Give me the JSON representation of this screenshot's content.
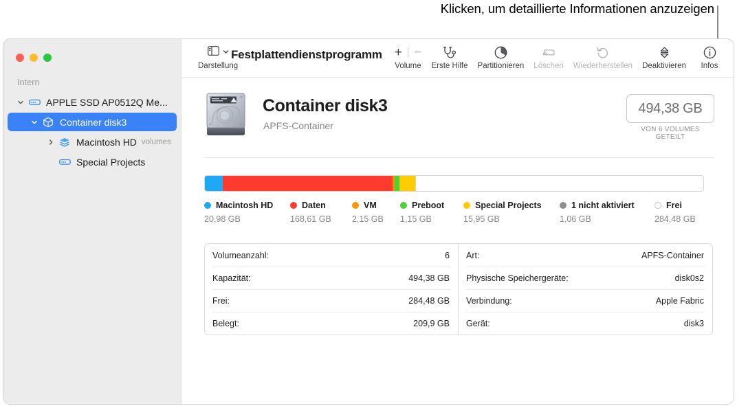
{
  "callout": {
    "text": "Klicken, um detaillierte Informationen anzuzeigen"
  },
  "sidebar": {
    "section_label": "Intern",
    "items": [
      {
        "label": "APPLE SSD AP0512Q Me...",
        "icon": "external-drive-icon",
        "twisty": "chevron-down",
        "sublabel": "",
        "indent": 1,
        "selected": false
      },
      {
        "label": "Container disk3",
        "icon": "container-box-icon",
        "twisty": "chevron-down",
        "sublabel": "",
        "indent": 2,
        "selected": true
      },
      {
        "label": "Macintosh HD",
        "icon": "volume-group-icon",
        "twisty": "chevron-right",
        "sublabel": "volumes",
        "indent": 3,
        "selected": false
      },
      {
        "label": "Special Projects",
        "icon": "external-drive-icon",
        "twisty": "",
        "sublabel": "",
        "indent": 3,
        "selected": false
      }
    ]
  },
  "toolbar": {
    "app_title": "Festplattendienstprogramm",
    "view_caption": "Darstellung",
    "view_icon": "sidebar-icon",
    "view_chevron": "chevron-down-icon",
    "items": [
      {
        "caption": "Volume",
        "icon": "plus-minus-icon",
        "disabled": false
      },
      {
        "caption": "Erste Hilfe",
        "icon": "stethoscope-icon",
        "disabled": false
      },
      {
        "caption": "Partitionieren",
        "icon": "pie-chart-icon",
        "disabled": false
      },
      {
        "caption": "Löschen",
        "icon": "erase-drive-icon",
        "disabled": true
      },
      {
        "caption": "Wiederherstellen",
        "icon": "restore-arrow-icon",
        "disabled": true
      },
      {
        "caption": "Deaktivieren",
        "icon": "eject-unmount-icon",
        "disabled": false
      },
      {
        "caption": "Infos",
        "icon": "info-circle-icon",
        "disabled": false
      }
    ]
  },
  "header": {
    "disk_icon": "hard-disk-icon",
    "title": "Container disk3",
    "subtitle": "APFS-Container",
    "capacity": "494,38 GB",
    "capacity_note": "VON 6 VOLUMES GETEILT"
  },
  "chart_data": {
    "type": "bar",
    "title": "Container disk3 Speicherbelegung",
    "orientation": "horizontal-stacked",
    "total": 494.38,
    "unit": "GB",
    "categories": [
      "Macintosh HD",
      "Daten",
      "VM",
      "Preboot",
      "Special Projects",
      "1 nicht aktiviert",
      "Frei"
    ],
    "values": [
      20.98,
      168.61,
      2.15,
      1.15,
      15.95,
      1.06,
      284.48
    ],
    "value_labels": [
      "20,98 GB",
      "168,61 GB",
      "2,15 GB",
      "1,15 GB",
      "15,95 GB",
      "1,06 GB",
      "284,48 GB"
    ],
    "colors": [
      "#1fa9f5",
      "#ff3b30",
      "#ff9500",
      "#4cd137",
      "#ffcc00",
      "#8e8e93",
      "#ffffff"
    ],
    "legend_position": "below"
  },
  "info": {
    "left_rows": [
      {
        "key": "Volumeanzahl:",
        "value": "6"
      },
      {
        "key": "Kapazität:",
        "value": "494,38 GB"
      },
      {
        "key": "Frei:",
        "value": "284,48 GB"
      },
      {
        "key": "Belegt:",
        "value": "209,9 GB"
      }
    ],
    "right_rows": [
      {
        "key": "Art:",
        "value": "APFS-Container"
      },
      {
        "key": "Physische Speichergeräte:",
        "value": "disk0s2"
      },
      {
        "key": "Verbindung:",
        "value": "Apple Fabric"
      },
      {
        "key": "Gerät:",
        "value": "disk3"
      }
    ]
  }
}
